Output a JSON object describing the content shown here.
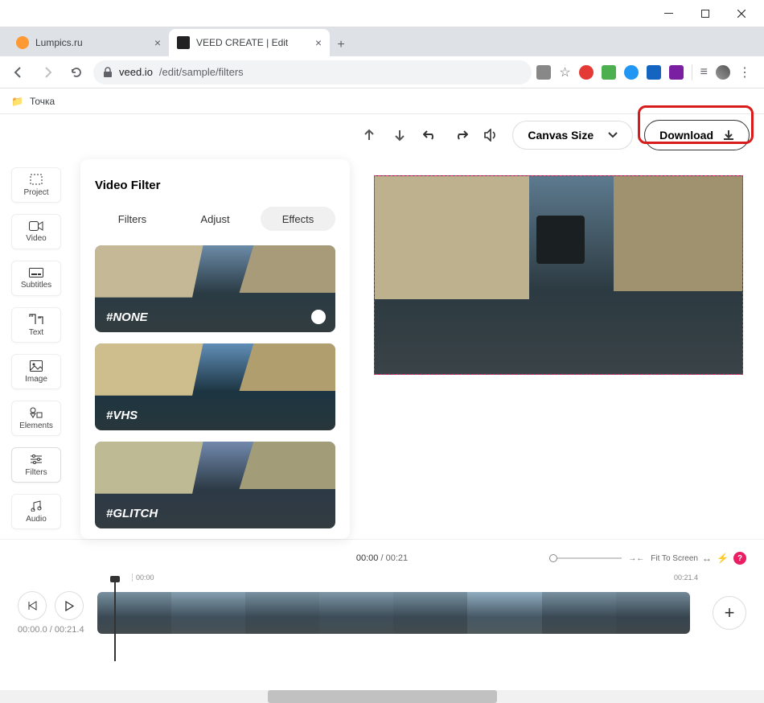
{
  "window": {
    "title": "VEED CREATE | Edit"
  },
  "tabs": [
    {
      "title": "Lumpics.ru",
      "active": false
    },
    {
      "title": "VEED CREATE | Edit",
      "active": true
    }
  ],
  "url": {
    "domain": "veed.io",
    "path": "/edit/sample/filters"
  },
  "bookmarks": {
    "item1": "Точка"
  },
  "toolbar": {
    "canvas_size": "Canvas Size",
    "download": "Download"
  },
  "sidebar": {
    "items": [
      {
        "label": "Project"
      },
      {
        "label": "Video"
      },
      {
        "label": "Subtitles"
      },
      {
        "label": "Text"
      },
      {
        "label": "Image"
      },
      {
        "label": "Elements"
      },
      {
        "label": "Filters"
      },
      {
        "label": "Audio"
      }
    ]
  },
  "panel": {
    "title": "Video Filter",
    "tabs": {
      "filters": "Filters",
      "adjust": "Adjust",
      "effects": "Effects"
    },
    "effects": [
      {
        "label": "#NONE",
        "selected": true
      },
      {
        "label": "#VHS",
        "selected": false
      },
      {
        "label": "#GLITCH",
        "selected": false
      }
    ]
  },
  "timeline": {
    "current": "00:00",
    "total": "00:21",
    "zoom_label": "Fit To Screen",
    "ruler_start": "00:00",
    "ruler_end": "00:21.4",
    "playback_current": "00:00.0",
    "playback_total": "00:21.4"
  }
}
